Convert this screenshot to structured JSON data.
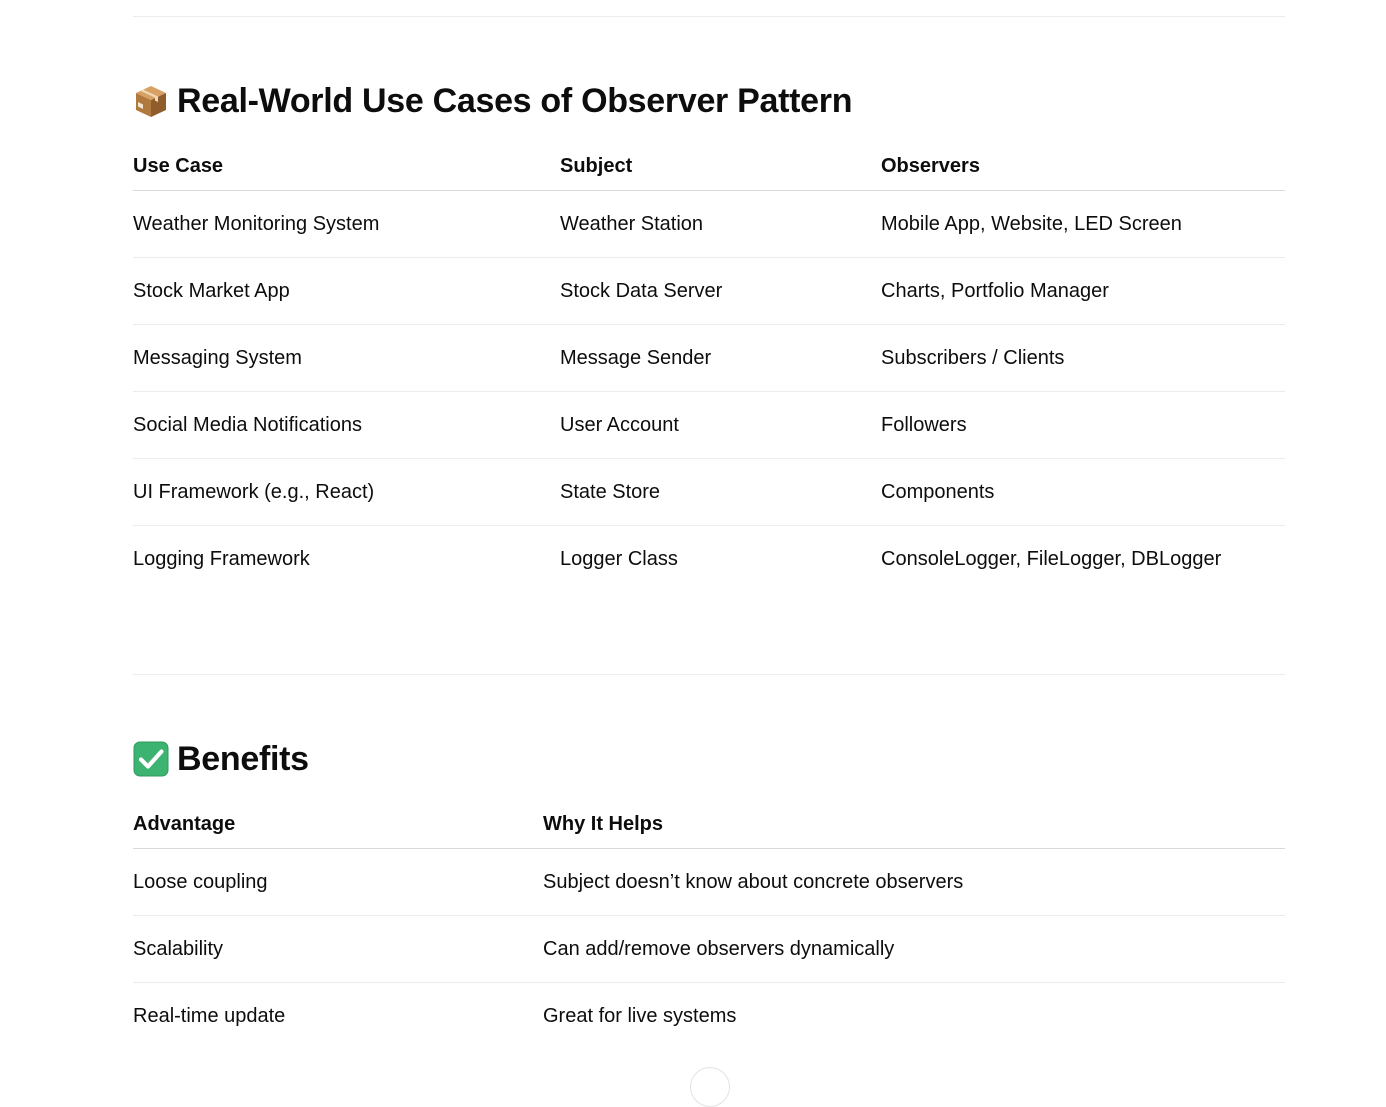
{
  "use_cases": {
    "emoji": "package-icon",
    "title": "Real-World Use Cases of Observer Pattern",
    "columns": [
      "Use Case",
      "Subject",
      "Observers"
    ],
    "rows": [
      [
        "Weather Monitoring System",
        "Weather Station",
        "Mobile App, Website, LED Screen"
      ],
      [
        "Stock Market App",
        "Stock Data Server",
        "Charts, Portfolio Manager"
      ],
      [
        "Messaging System",
        "Message Sender",
        "Subscribers / Clients"
      ],
      [
        "Social Media Notifications",
        "User Account",
        "Followers"
      ],
      [
        "UI Framework (e.g., React)",
        "State Store",
        "Components"
      ],
      [
        "Logging Framework",
        "Logger Class",
        "ConsoleLogger, FileLogger, DBLogger"
      ]
    ]
  },
  "benefits": {
    "emoji": "check-mark-button-icon",
    "title": "Benefits",
    "columns": [
      "Advantage",
      "Why It Helps"
    ],
    "rows": [
      [
        "Loose coupling",
        "Subject doesn’t know about concrete observers"
      ],
      [
        "Scalability",
        "Can add/remove observers dynamically"
      ],
      [
        "Real-time update",
        "Great for live systems"
      ]
    ]
  },
  "colors": {
    "text": "#0d0d0d",
    "divider": "#ececec",
    "header_rule": "#d9d9d9",
    "check_green": "#3cb371"
  }
}
